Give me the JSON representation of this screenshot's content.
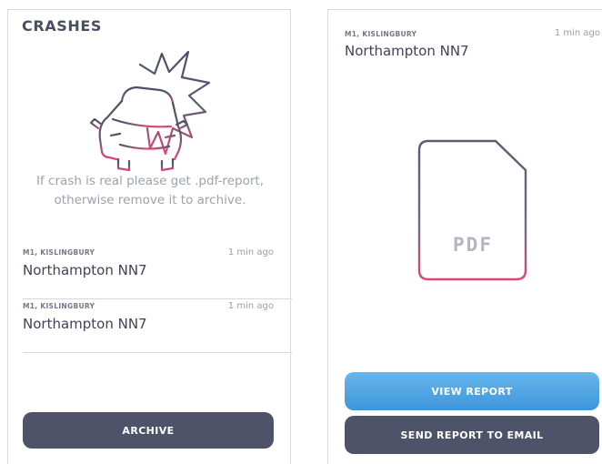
{
  "left_screen": {
    "title": "CRASHES",
    "hint_line1": "If crash is real please get .pdf-report,",
    "hint_line2": "otherwise remove it to archive.",
    "crashes": [
      {
        "road": "M1, KISLINGBURY",
        "time": "1 min ago",
        "place": "Northampton NN7"
      },
      {
        "road": "M1, KISLINGBURY",
        "time": "1 min ago",
        "place": "Northampton NN7"
      }
    ],
    "archive_label": "ARCHIVE"
  },
  "right_screen": {
    "road": "M1, KISLINGBURY",
    "time": "1 min ago",
    "place": "Northampton NN7",
    "pdf_text": "PDF",
    "view_label": "VIEW REPORT",
    "email_label": "SEND REPORT TO EMAIL"
  },
  "icons": {
    "crash_illustration": "car-crash-icon",
    "document": "pdf-document-icon"
  },
  "colors": {
    "primary_dark": "#4f536a",
    "accent_blue": "#4aa3e3",
    "accent_pink": "#e0457a"
  }
}
